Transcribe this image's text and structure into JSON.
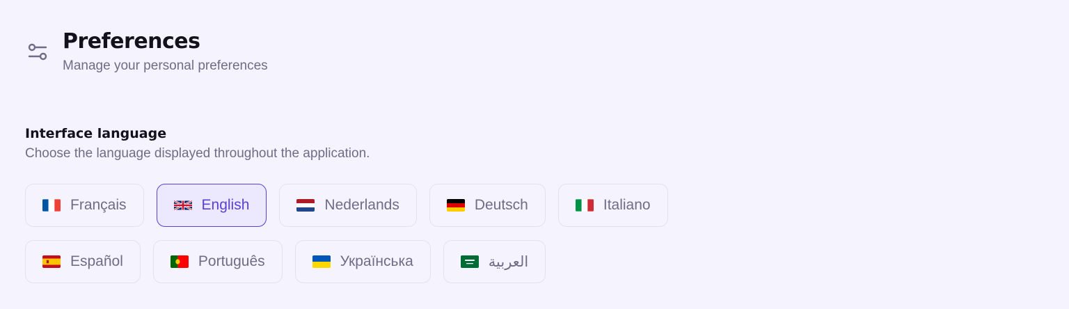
{
  "header": {
    "icon": "sliders-icon",
    "title": "Preferences",
    "subtitle": "Manage your personal preferences"
  },
  "section": {
    "title": "Interface language",
    "description": "Choose the language displayed throughout the application."
  },
  "colors": {
    "background": "#f5f3fe",
    "accent": "#5b3fd6",
    "selected_bg": "#ece8fd",
    "border": "#e3e0f3",
    "muted_text": "#6f6c86"
  },
  "languages": {
    "selected": "English",
    "options": [
      {
        "label": "Français",
        "flag": "france-flag-icon"
      },
      {
        "label": "English",
        "flag": "uk-flag-icon"
      },
      {
        "label": "Nederlands",
        "flag": "netherlands-flag-icon"
      },
      {
        "label": "Deutsch",
        "flag": "germany-flag-icon"
      },
      {
        "label": "Italiano",
        "flag": "italy-flag-icon"
      },
      {
        "label": "Español",
        "flag": "spain-flag-icon"
      },
      {
        "label": "Português",
        "flag": "portugal-flag-icon"
      },
      {
        "label": "Українська",
        "flag": "ukraine-flag-icon"
      },
      {
        "label": "العربية",
        "flag": "saudi-arabia-flag-icon"
      }
    ]
  }
}
